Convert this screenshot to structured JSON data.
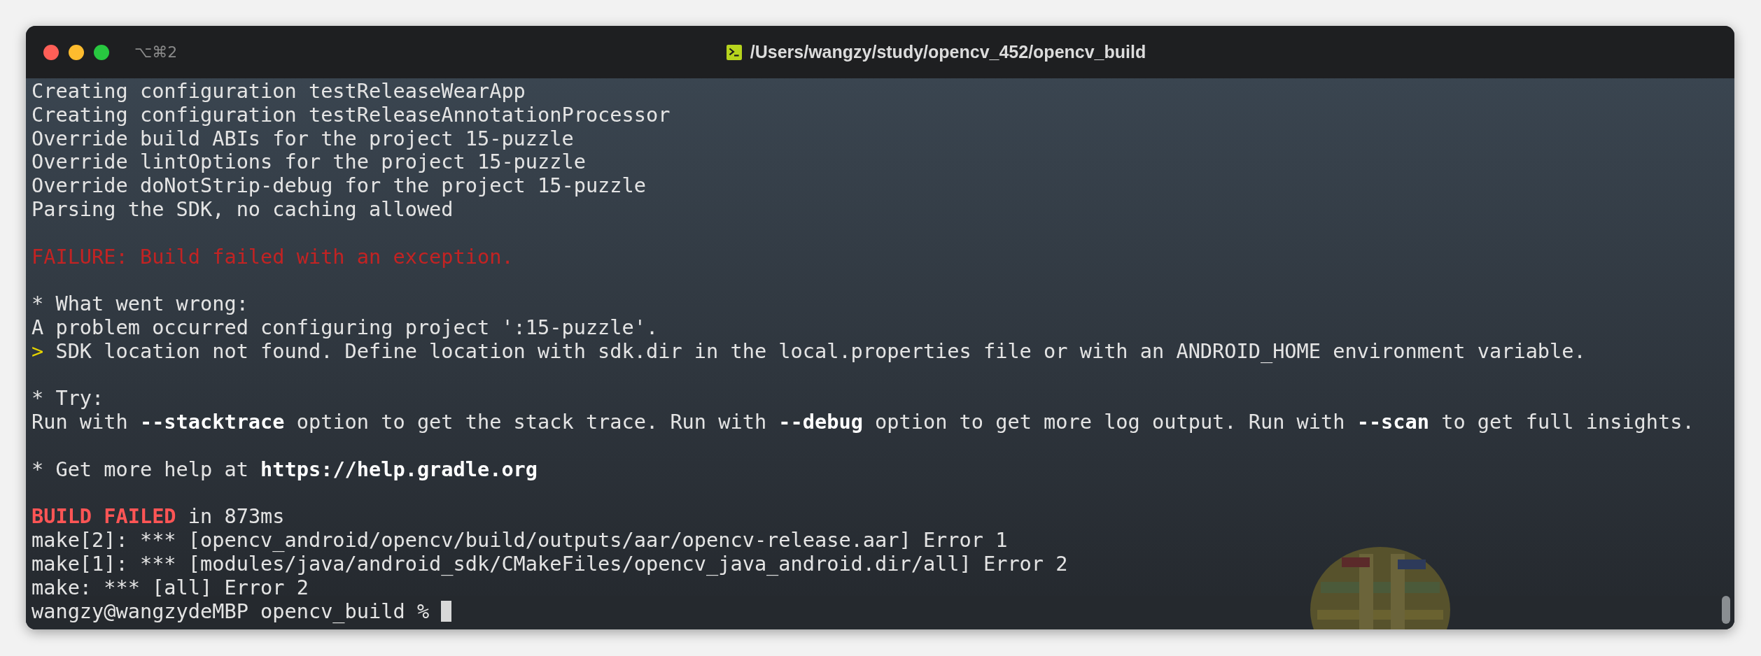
{
  "window": {
    "shortcut": "⌥⌘2",
    "title": "/Users/wangzy/study/opencv_452/opencv_build"
  },
  "lines": [
    {
      "kind": "text",
      "segments": [
        {
          "kind": "plain",
          "text": "Creating configuration testReleaseWearApp"
        }
      ]
    },
    {
      "kind": "text",
      "segments": [
        {
          "kind": "plain",
          "text": "Creating configuration testReleaseAnnotationProcessor"
        }
      ]
    },
    {
      "kind": "text",
      "segments": [
        {
          "kind": "plain",
          "text": "Override build ABIs for the project 15-puzzle"
        }
      ]
    },
    {
      "kind": "text",
      "segments": [
        {
          "kind": "plain",
          "text": "Override lintOptions for the project 15-puzzle"
        }
      ]
    },
    {
      "kind": "text",
      "segments": [
        {
          "kind": "plain",
          "text": "Override doNotStrip-debug for the project 15-puzzle"
        }
      ]
    },
    {
      "kind": "text",
      "segments": [
        {
          "kind": "plain",
          "text": "Parsing the SDK, no caching allowed"
        }
      ]
    },
    {
      "kind": "blank"
    },
    {
      "kind": "text",
      "segments": [
        {
          "kind": "error",
          "text": "FAILURE: Build failed with an exception."
        }
      ]
    },
    {
      "kind": "blank"
    },
    {
      "kind": "text",
      "segments": [
        {
          "kind": "plain",
          "text": "* What went wrong:"
        }
      ]
    },
    {
      "kind": "text",
      "segments": [
        {
          "kind": "plain",
          "text": "A problem occurred configuring project ':15-puzzle'."
        }
      ]
    },
    {
      "kind": "text",
      "segments": [
        {
          "kind": "marker",
          "text": ">"
        },
        {
          "kind": "plain",
          "text": " SDK location not found. Define location with sdk.dir in the local.properties file or with an ANDROID_HOME environment variable."
        }
      ]
    },
    {
      "kind": "blank"
    },
    {
      "kind": "text",
      "segments": [
        {
          "kind": "plain",
          "text": "* Try:"
        }
      ]
    },
    {
      "kind": "text",
      "segments": [
        {
          "kind": "plain",
          "text": "Run with "
        },
        {
          "kind": "bold",
          "text": "--stacktrace"
        },
        {
          "kind": "plain",
          "text": " option to get the stack trace. Run with "
        },
        {
          "kind": "bold",
          "text": "--debug"
        },
        {
          "kind": "plain",
          "text": " option to get more log output. Run with "
        },
        {
          "kind": "bold",
          "text": "--scan"
        },
        {
          "kind": "plain",
          "text": " to get full insights."
        }
      ]
    },
    {
      "kind": "blank"
    },
    {
      "kind": "text",
      "segments": [
        {
          "kind": "plain",
          "text": "* Get more help at "
        },
        {
          "kind": "bold",
          "text": "https://help.gradle.org"
        }
      ]
    },
    {
      "kind": "blank"
    },
    {
      "kind": "text",
      "segments": [
        {
          "kind": "failed",
          "text": "BUILD FAILED"
        },
        {
          "kind": "plain",
          "text": " in 873ms"
        }
      ]
    },
    {
      "kind": "text",
      "segments": [
        {
          "kind": "plain",
          "text": "make[2]: *** [opencv_android/opencv/build/outputs/aar/opencv-release.aar] Error 1"
        }
      ]
    },
    {
      "kind": "text",
      "segments": [
        {
          "kind": "plain",
          "text": "make[1]: *** [modules/java/android_sdk/CMakeFiles/opencv_java_android.dir/all] Error 2"
        }
      ]
    },
    {
      "kind": "text",
      "segments": [
        {
          "kind": "plain",
          "text": "make: *** [all] Error 2"
        }
      ]
    },
    {
      "kind": "prompt",
      "segments": [
        {
          "kind": "plain",
          "text": "wangzy@wangzydeMBP opencv_build % "
        }
      ]
    }
  ]
}
